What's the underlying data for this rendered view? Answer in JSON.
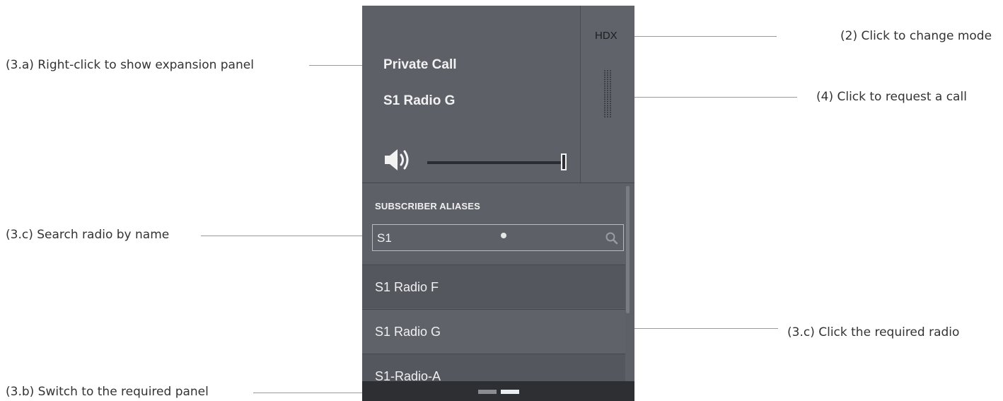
{
  "annotations": {
    "change_mode": "(2) Click to change mode",
    "expansion_panel": "(3.a) Right-click to show expansion panel",
    "request_call": "(4) Click to request a call",
    "search_radio": "(3.c) Search radio by name",
    "click_radio": "(3.c) Click the required radio",
    "switch_panel": "(3.b) Switch to the required panel"
  },
  "call_panel": {
    "call_type": "Private Call",
    "target": "S1 Radio G",
    "mode_label": "HDX",
    "volume_level": 1.0
  },
  "alias_list": {
    "header": "SUBSCRIBER ALIASES",
    "search_value": "S1",
    "items": [
      {
        "label": "S1 Radio F"
      },
      {
        "label": "S1 Radio G"
      },
      {
        "label": "S1-Radio-A"
      }
    ]
  },
  "page_indicator": {
    "count": 2,
    "active_index": 1
  },
  "icons": {
    "speaker": "speaker-icon",
    "search": "search-icon",
    "ptt": "ptt-grip-icon"
  }
}
